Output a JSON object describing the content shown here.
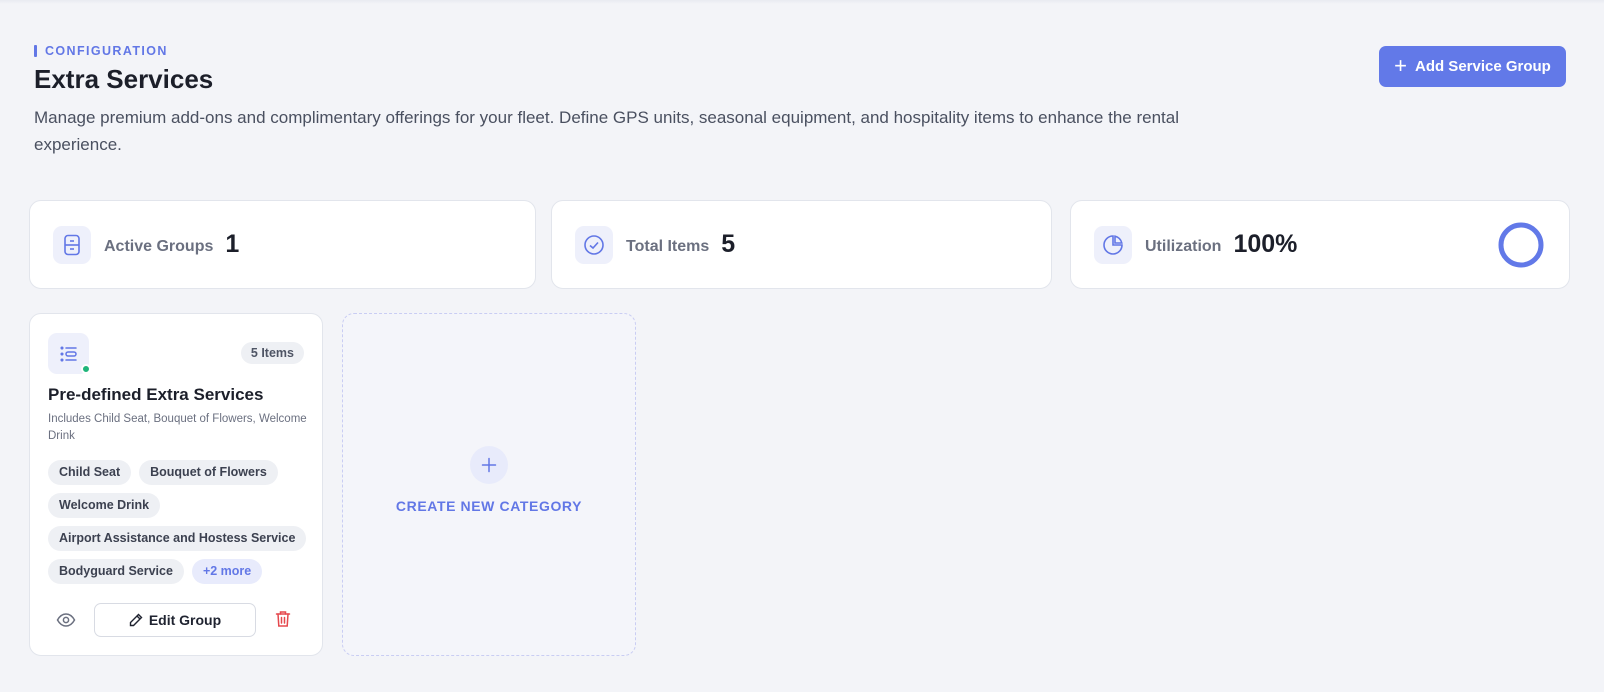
{
  "header": {
    "eyebrow": "CONFIGURATION",
    "title": "Extra Services",
    "subtitle": "Manage premium add-ons and complimentary offerings for your fleet. Define GPS units, seasonal equipment, and hospitality items to enhance the rental experience.",
    "add_button_label": "Add Service Group"
  },
  "stats": [
    {
      "label": "Active Groups",
      "value": "1",
      "icon": "box-icon"
    },
    {
      "label": "Total Items",
      "value": "5",
      "icon": "check-circle-icon"
    },
    {
      "label": "Utilization",
      "value": "100%",
      "icon": "pie-chart-icon",
      "ring_fraction": 1.0
    }
  ],
  "group": {
    "count_badge": "5 Items",
    "title": "Pre-defined Extra Services",
    "description": "Includes Child Seat, Bouquet of Flowers, Welcome Drink",
    "tags": [
      "Child Seat",
      "Bouquet of Flowers",
      "Welcome Drink",
      "Airport Assistance and Hostess Service",
      "Bodyguard Service"
    ],
    "more_tag": "+2 more",
    "edit_label": "Edit Group",
    "status": "active"
  },
  "create": {
    "label": "CREATE NEW CATEGORY"
  },
  "colors": {
    "accent": "#6279e8",
    "status_active": "#1fb57a",
    "danger": "#e5484d"
  }
}
